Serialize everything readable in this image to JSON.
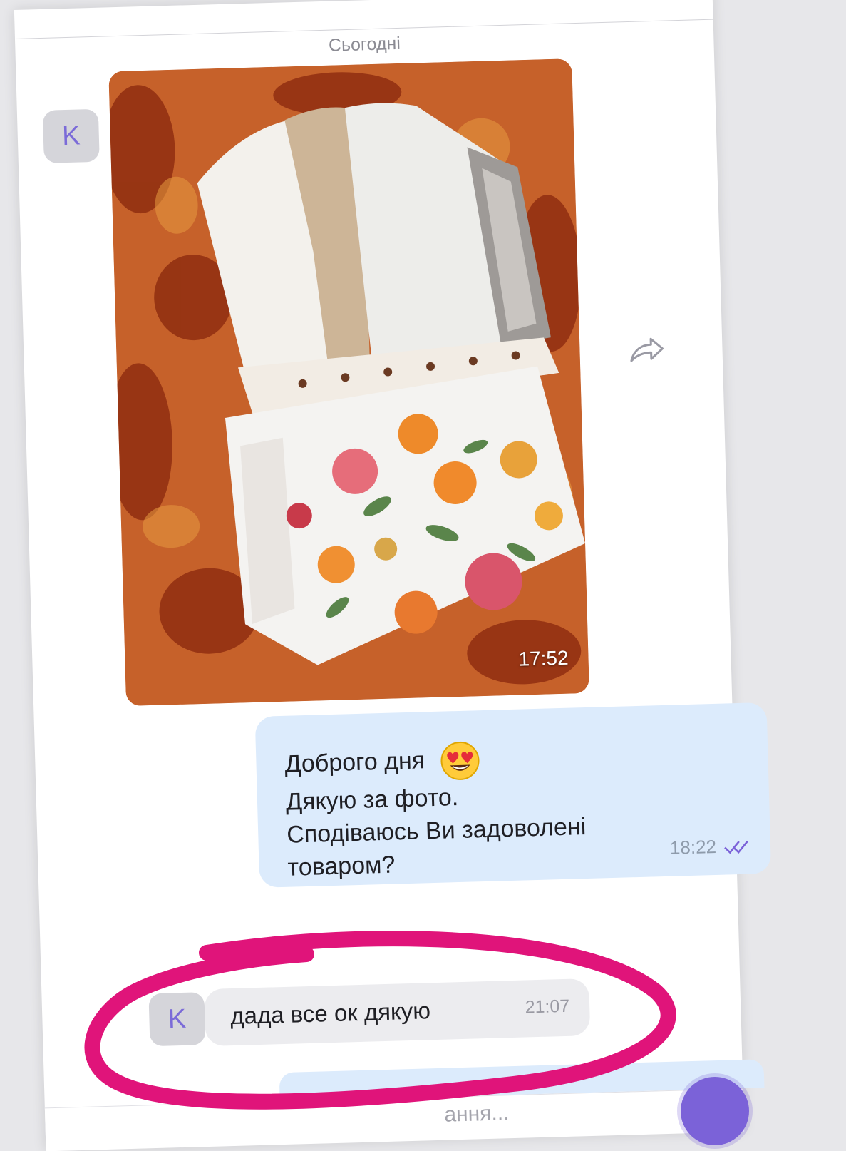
{
  "conversation": {
    "date_separator": "Сьогодні",
    "contact_initial": "K"
  },
  "photo_message": {
    "time": "17:52"
  },
  "outgoing_message": {
    "lines": [
      "Доброго дня",
      "Дякую за фото.",
      "Сподіваюсь Ви задоволені",
      "товаром?"
    ],
    "emoji": "smiling-face-with-heart-eyes",
    "time": "18:22",
    "status": "read"
  },
  "incoming_message": {
    "text": "дада все ок дякую",
    "time": "21:07"
  },
  "composer": {
    "placeholder": "ання..."
  },
  "colors": {
    "accent": "#7b62d8",
    "outgoing_bubble": "#dcebfc",
    "incoming_bubble": "#ececef",
    "highlight": "#e0147a"
  }
}
